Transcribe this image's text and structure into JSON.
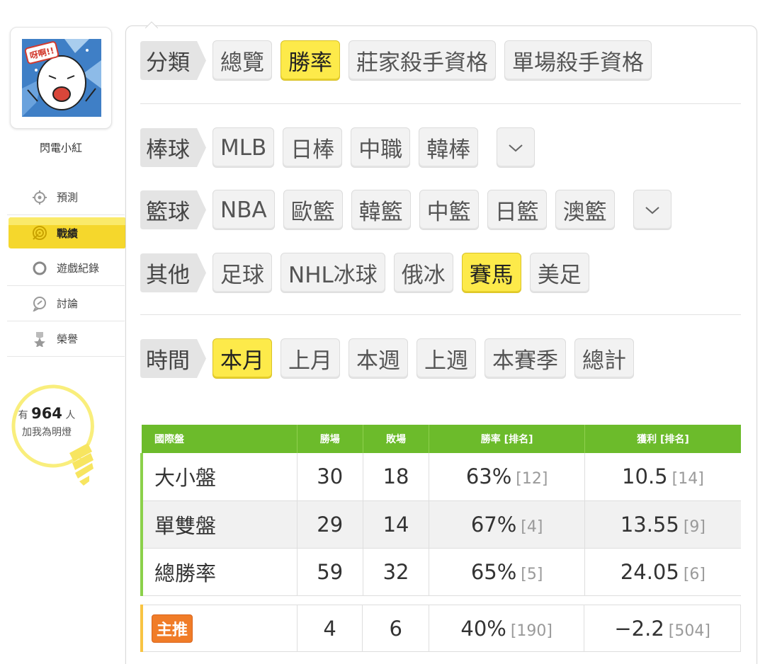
{
  "profile": {
    "name": "閃電小紅",
    "avatar_text": "呀啊!!"
  },
  "nav": [
    {
      "label": "預測",
      "icon": "crosshair-icon",
      "active": false
    },
    {
      "label": "戰績",
      "icon": "target-icon",
      "active": true
    },
    {
      "label": "遊戲紀錄",
      "icon": "circle-icon",
      "active": false
    },
    {
      "label": "討論",
      "icon": "chat-icon",
      "active": false
    },
    {
      "label": "榮譽",
      "icon": "medal-icon",
      "active": false
    }
  ],
  "fans": {
    "prefix": "有",
    "count": "964",
    "suffix": "人",
    "line2": "加我為明燈"
  },
  "filters": {
    "category": {
      "label": "分類",
      "options": [
        "總覽",
        "勝率",
        "莊家殺手資格",
        "單場殺手資格"
      ],
      "selected": "勝率"
    },
    "baseball": {
      "label": "棒球",
      "options": [
        "MLB",
        "日棒",
        "中職",
        "韓棒"
      ]
    },
    "basketball": {
      "label": "籃球",
      "options": [
        "NBA",
        "歐籃",
        "韓籃",
        "中籃",
        "日籃",
        "澳籃"
      ]
    },
    "other": {
      "label": "其他",
      "options": [
        "足球",
        "NHL冰球",
        "俄冰",
        "賽馬",
        "美足"
      ],
      "selected": "賽馬"
    },
    "time": {
      "label": "時間",
      "options": [
        "本月",
        "上月",
        "本週",
        "上週",
        "本賽季",
        "總計"
      ],
      "selected": "本月"
    }
  },
  "table": {
    "headers": [
      "國際盤",
      "勝場",
      "敗場",
      "勝率 [排名]",
      "獲利 [排名]"
    ],
    "rows": [
      {
        "name": "大小盤",
        "wins": "30",
        "losses": "18",
        "rate": "63%",
        "rate_rank": "[12]",
        "profit": "10.5",
        "profit_rank": "[14]"
      },
      {
        "name": "單雙盤",
        "wins": "29",
        "losses": "14",
        "rate": "67%",
        "rate_rank": "[4]",
        "profit": "13.55",
        "profit_rank": "[9]"
      },
      {
        "name": "總勝率",
        "wins": "59",
        "losses": "32",
        "rate": "65%",
        "rate_rank": "[5]",
        "profit": "24.05",
        "profit_rank": "[6]"
      }
    ],
    "featured": {
      "badge": "主推",
      "wins": "4",
      "losses": "6",
      "rate": "40%",
      "rate_rank": "[190]",
      "profit": "−2.2",
      "profit_rank": "[504]"
    }
  },
  "colors": {
    "selected_tag": "#fdea4a",
    "header_green": "#6cbb2b",
    "featured_badge": "#f07c28",
    "active_nav": "#f7e13c"
  }
}
